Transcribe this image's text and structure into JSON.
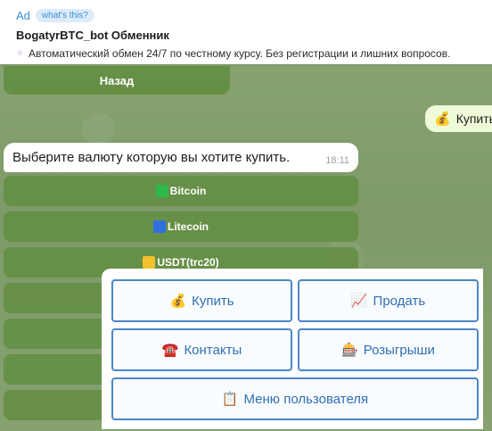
{
  "ad": {
    "label": "Ad",
    "whats_this": "what's this?",
    "title": "BogatyrBTC_bot Обменник",
    "description": "Автоматический обмен 24/7 по честному курсу. Без регистрации и лишних вопросов."
  },
  "back_button": "Назад",
  "outgoing": {
    "emoji": "💰",
    "text": "Купить"
  },
  "incoming": {
    "text": "Выберите валюту которую вы хотите купить.",
    "time": "18:11"
  },
  "currency_buttons": [
    {
      "label": "Bitcoin",
      "color": "#2fb84a"
    },
    {
      "label": "Litecoin",
      "color": "#2f6fe0"
    },
    {
      "label": "USDT(trc20)",
      "color": "#f2c12e"
    }
  ],
  "keyboard": {
    "buy": {
      "emoji": "💰",
      "label": "Купить"
    },
    "sell": {
      "emoji": "📈",
      "label": "Продать"
    },
    "contacts": {
      "emoji": "☎️",
      "label": "Контакты"
    },
    "giveaways": {
      "emoji": "🎰",
      "label": "Розыгрыши"
    },
    "user_menu": {
      "emoji": "📋",
      "label": "Меню пользователя"
    }
  }
}
